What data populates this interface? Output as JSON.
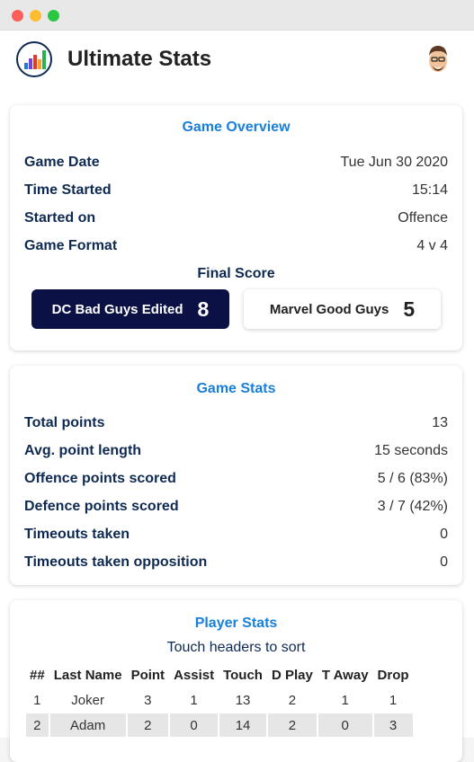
{
  "app": {
    "title": "Ultimate Stats"
  },
  "overview": {
    "title": "Game Overview",
    "rows": [
      {
        "label": "Game Date",
        "value": "Tue Jun 30 2020"
      },
      {
        "label": "Time Started",
        "value": "15:14"
      },
      {
        "label": "Started on",
        "value": "Offence"
      },
      {
        "label": "Game Format",
        "value": "4 v 4"
      }
    ],
    "final_score_label": "Final Score",
    "home": {
      "name": "DC Bad Guys Edited",
      "score": "8"
    },
    "away": {
      "name": "Marvel Good Guys",
      "score": "5"
    }
  },
  "game_stats": {
    "title": "Game Stats",
    "rows": [
      {
        "label": "Total points",
        "value": "13"
      },
      {
        "label": "Avg. point length",
        "value": "15 seconds"
      },
      {
        "label": "Offence points scored",
        "value": "5 / 6 (83%)"
      },
      {
        "label": "Defence points scored",
        "value": "3 / 7 (42%)"
      },
      {
        "label": "Timeouts taken",
        "value": "0"
      },
      {
        "label": "Timeouts taken opposition",
        "value": "0"
      }
    ]
  },
  "player_stats": {
    "title": "Player Stats",
    "subtitle": "Touch headers to sort",
    "headers": [
      "##",
      "Last Name",
      "Point",
      "Assist",
      "Touch",
      "D Play",
      "T Away",
      "Drop"
    ],
    "rows": [
      [
        "1",
        "Joker",
        "3",
        "1",
        "13",
        "2",
        "1",
        "1"
      ],
      [
        "2",
        "Adam",
        "2",
        "0",
        "14",
        "2",
        "0",
        "3"
      ]
    ]
  },
  "colors": {
    "accent": "#1a7fd8",
    "label": "#0f2a52",
    "home_team_bg": "#0b1145"
  },
  "icons": {
    "logo": "bar-chart-icon",
    "avatar": "user-avatar"
  }
}
